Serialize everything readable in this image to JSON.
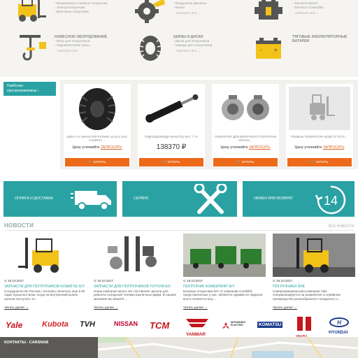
{
  "categories": [
    {
      "icon": "forklift-icon",
      "title": "",
      "sub": [
        "› Бензиновые и газовые погрузчики",
        "› Электропогрузчики",
        "› Вилочные погрузчики"
      ],
      "more": ""
    },
    {
      "icon": "gear-excavator-icon",
      "title": "",
      "sub": [
        "› Воздушные фильтры",
        "› Вилки"
      ],
      "more": "Смотреть все →"
    },
    {
      "icon": "engine-icon",
      "title": "",
      "sub": [
        "› Запчасти Bosch",
        "› Запчасти Caterpillar"
      ],
      "more": "Смотреть все →"
    },
    {
      "icon": "crane-hook-icon",
      "title": "НАВЕСНОЕ ОБОРУДОВАНИЕ",
      "sub": [
        "› Вилы для погрузчиков",
        "› Гидравлические грузы"
      ],
      "more": "Смотреть все →"
    },
    {
      "icon": "tire-icon",
      "title": "ШИНЫ И ДИСКИ",
      "sub": [
        "› Диски для погрузчиков",
        "› Камеры для погрузчиков"
      ],
      "more": "Смотреть все →"
    },
    {
      "icon": "battery-icon",
      "title": "ТЯГОВЫЕ АККУМУЛЯТОРНЫЕ БАТАРЕИ",
      "sub": [],
      "more": ""
    }
  ],
  "recent": {
    "label": "Наиболее просматриваемые  ›"
  },
  "cards": [
    {
      "title1": "ШИНА НА МИНИ-ПОГРУЗЧИК 10-16.5 SKS,",
      "title2": "НАШИНА ...",
      "price_q": "Цену уточняйте",
      "price_link": "ЗАПРОСИТЬ",
      "price": "",
      "buy": "🛒 КУПИТЬ"
    },
    {
      "title1": "ГИДРОЦИЛИНДР, MANITOU MLT 7 TV",
      "title2": "",
      "price_q": "",
      "price_link": "",
      "price": "138370 ₽",
      "buy": "🛒 КУПИТЬ"
    },
    {
      "title1": "ГЕНЕРАТОР ДЛЯ ВИЛОЧНОГО ПОГРУЗЧИКА",
      "title2": "NISSAN ...",
      "price_q": "Цену уточняйте",
      "price_link": "ЗАПРОСИТЬ",
      "price": "",
      "buy": "🛒 КУПИТЬ"
    },
    {
      "title1": "РЕМЕНЬ ГЕНЕРАТОРА BOBCAT S175 ...",
      "title2": "",
      "price_q": "Цену уточняйте",
      "price_link": "ЗАПРОСИТЬ",
      "price": "",
      "buy": "🛒 КУПИТЬ"
    }
  ],
  "services": [
    {
      "label": "ОПЛАТА И ДОСТАВКА",
      "icon": "truck-icon"
    },
    {
      "label": "СЕРВИС",
      "icon": "tools-icon"
    },
    {
      "label": "ОБМЕН ИЛИ ВОЗВРАТ",
      "icon": "return-14-icon",
      "badge": "14"
    }
  ],
  "news": {
    "heading": "НОВОСТИ",
    "all": "ВСЕ НОВОСТИ →",
    "items": [
      {
        "date": "⊙ 16.10.2017",
        "title": "ЗАПЧАСТИ ДЛЯ ПОГРУЗЧИКОВ KOMATSU Б/У",
        "text": "Сотрудничество России с Komatsu началось еще в 80 годах прошлого века, когда на внутренний рынок начали поступать те...",
        "more": "Читать далее →"
      },
      {
        "date": "⊙ 16.10.2017",
        "title": "ЗАПЧАСТИ ДЛЯ ПОГРУЗЧИКОВ TOYOTA Б/У",
        "text": "Наша компания много лет поставляет детали для ремонта складской техники различных фирм. В нашем магазине вы можете ...",
        "more": "Читать далее →"
      },
      {
        "date": "⊙ 16.10.2017",
        "title": "ПОГРУЗЧИК КОМБИЛИФТ Б/У",
        "text": "Боковые погрузчики Б/У от компании Combilift, представленные у нас, являются одними из лидеров всего сегмента погр...",
        "more": "Читать далее →"
      },
      {
        "date": "⊙ 16.10.2017",
        "title": "ПОГРУЗЧИКИ ЯЛЕ",
        "text": "Североамериканская компания Yale специализируется на разработке и серийном производстве разнообразного складского о...",
        "more": "Читать далее →"
      }
    ]
  },
  "brands": [
    "Yale",
    "Kubota",
    "TVH",
    "NISSAN",
    "TCM",
    "YANMAR",
    "MITSUBISHI ELECTRIC",
    "KOMATSU",
    "ISUZU",
    "HYUNDAI"
  ],
  "footer": {
    "contacts": "КОНТАКТЫ - CARSNAB"
  },
  "colors": {
    "teal": "#2aa2a3",
    "orange": "#ec6a1a",
    "yellow": "#f2c218",
    "dark": "#5b5a57"
  }
}
